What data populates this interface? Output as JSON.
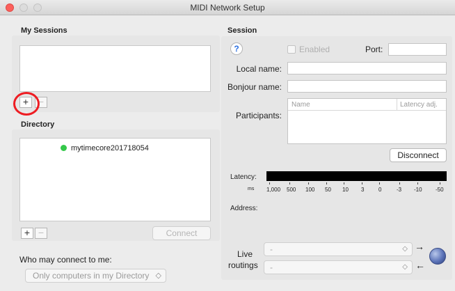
{
  "window": {
    "title": "MIDI Network Setup"
  },
  "my_sessions": {
    "title": "My Sessions",
    "add_label": "+",
    "remove_label": "−"
  },
  "directory": {
    "title": "Directory",
    "items": [
      {
        "name": "mytimecore201718054",
        "status_color": "#34c84a"
      }
    ],
    "add_label": "+",
    "remove_label": "−",
    "connect_label": "Connect"
  },
  "who_may_connect": {
    "label": "Who may connect to me:",
    "selected": "Only computers in my Directory",
    "arrows": "◇"
  },
  "session": {
    "title": "Session",
    "help_label": "?",
    "enabled_label": "Enabled",
    "port_label": "Port:",
    "port_value": "",
    "local_name_label": "Local name:",
    "local_name_value": "",
    "bonjour_name_label": "Bonjour name:",
    "bonjour_name_value": "",
    "participants_label": "Participants:",
    "participants_columns": [
      "Name",
      "Latency adj."
    ],
    "disconnect_label": "Disconnect",
    "latency_label": "Latency:",
    "latency_unit": "ms",
    "latency_scale": [
      "1,000",
      "500",
      "100",
      "50",
      "10",
      "3",
      "0",
      "-3",
      "-10",
      "-50"
    ],
    "address_label": "Address:",
    "live_routings_label_1": "Live",
    "live_routings_label_2": "routings",
    "routing_in_value": "-",
    "routing_out_value": "-",
    "arrow_right": "→",
    "arrow_left": "←"
  },
  "colors": {
    "close": "#fc605c",
    "annotation": "#ee1d23"
  }
}
